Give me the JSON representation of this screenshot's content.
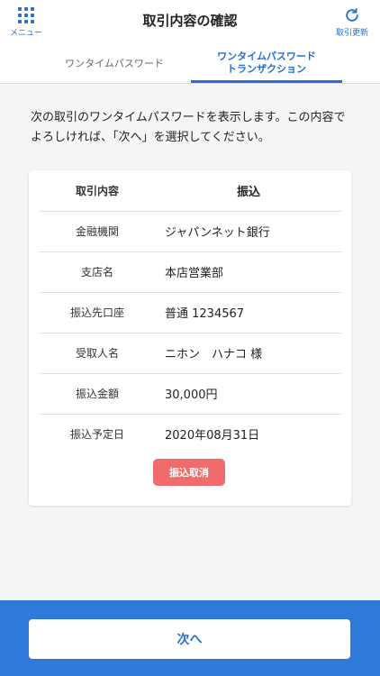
{
  "header": {
    "menu_label": "メニュー",
    "title": "取引内容の確認",
    "refresh_label": "取引更新"
  },
  "tabs": [
    {
      "label": "ワンタイムパスワード"
    },
    {
      "label_line1": "ワンタイムパスワード",
      "label_line2": "トランザクション"
    }
  ],
  "intro_text": "次の取引のワンタイムパスワードを表示します。この内容でよろしければ、「次へ」を選択してください。",
  "transaction": {
    "header_label": "取引内容",
    "header_value": "振込",
    "rows": [
      {
        "label": "金融機関",
        "value": "ジャパンネット銀行"
      },
      {
        "label": "支店名",
        "value": "本店営業部"
      },
      {
        "label": "振込先口座",
        "value": "普通 1234567"
      },
      {
        "label": "受取人名",
        "value": "ニホン　ハナコ 様"
      },
      {
        "label": "振込金額",
        "value": "30,000円"
      },
      {
        "label": "振込予定日",
        "value": "2020年08月31日"
      }
    ],
    "cancel_label": "振込取消"
  },
  "footer": {
    "next_label": "次へ"
  },
  "colors": {
    "accent": "#2a6fd0",
    "footer_bg": "#2f7ad8",
    "cancel": "#f06c6c"
  }
}
